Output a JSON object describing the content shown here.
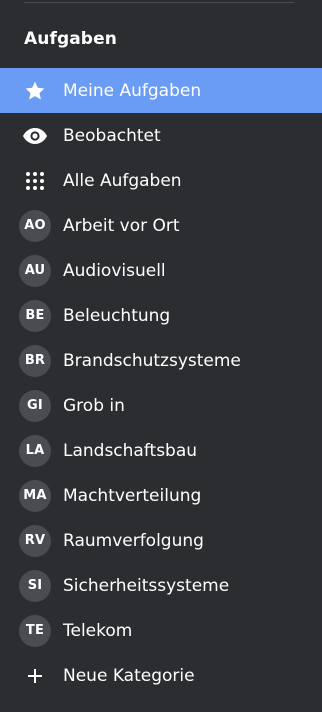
{
  "sidebar": {
    "section_title": "Aufgaben",
    "fixed_items": [
      {
        "label": "Meine Aufgaben",
        "icon": "star-icon",
        "active": true
      },
      {
        "label": "Beobachtet",
        "icon": "eye-icon",
        "active": false
      },
      {
        "label": "Alle Aufgaben",
        "icon": "grid-dots-icon",
        "active": false
      }
    ],
    "categories": [
      {
        "abbr": "AO",
        "label": "Arbeit vor Ort"
      },
      {
        "abbr": "AU",
        "label": "Audiovisuell"
      },
      {
        "abbr": "BE",
        "label": "Beleuchtung"
      },
      {
        "abbr": "BR",
        "label": "Brandschutzsysteme"
      },
      {
        "abbr": "GI",
        "label": "Grob in"
      },
      {
        "abbr": "LA",
        "label": "Landschaftsbau"
      },
      {
        "abbr": "MA",
        "label": "Machtverteilung"
      },
      {
        "abbr": "RV",
        "label": "Raumverfolgung"
      },
      {
        "abbr": "SI",
        "label": "Sicherheitssysteme"
      },
      {
        "abbr": "TE",
        "label": "Telekom"
      }
    ],
    "add_category": {
      "label": "Neue Kategorie",
      "icon": "plus-icon"
    }
  },
  "colors": {
    "background": "#2b2d31",
    "active_background": "#6b9cf5",
    "badge_background": "#4a4c52",
    "text": "#ffffff"
  }
}
